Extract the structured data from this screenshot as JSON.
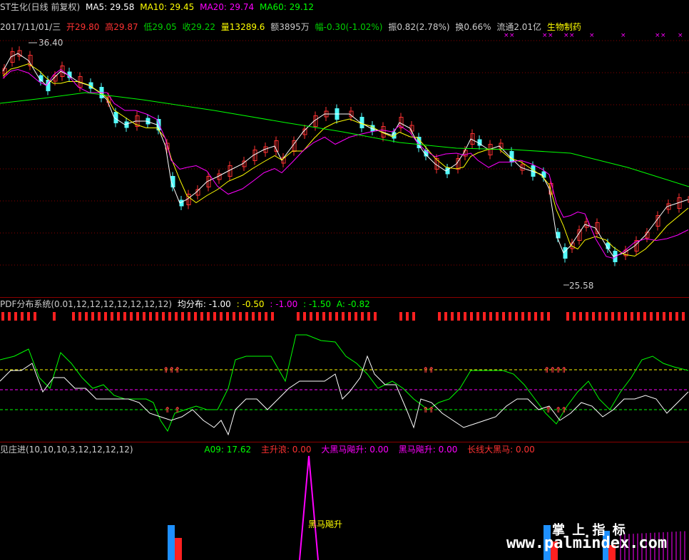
{
  "header": {
    "title": "ST生化(日线 前复权)",
    "ma5": "MA5: 29.58",
    "ma10": "MA10: 29.45",
    "ma20": "MA20: 29.74",
    "ma60": "MA60: 29.12"
  },
  "quote": {
    "date": "2017/11/01/三",
    "open": "开29.80",
    "high": "高29.87",
    "low": "低29.05",
    "close": "收29.22",
    "volume": "量13289.6",
    "amount": "额3895万",
    "change": "幅-0.30(-1.02%)",
    "amplitude": "振0.82(2.78%)",
    "turnover": "换0.66%",
    "float_cap": "流通2.01亿",
    "sector": "生物制药"
  },
  "price_labels": {
    "high": "36.40",
    "low": "25.58"
  },
  "pdf_panel": {
    "title": "PDF分布系统(0.01,12,12,12,12,12,12,12)",
    "avg_label": "均分布: -1.00",
    "v1": ": -0.50",
    "v2": ": -1.00",
    "v3": ": -1.50",
    "a": "A: -0.82"
  },
  "zhuang_panel": {
    "title": "见庄进(10,10,10,3,12,12,12,12)",
    "a09": "A09: 17.62",
    "zsl": "主升浪: 0.00",
    "dhmfs": "大黑马飚升: 0.00",
    "hmfs": "黑马飚升: 0.00",
    "cxdhm": "长线大黑马: 0.00",
    "annotation": "黑马飚升"
  },
  "watermark": {
    "cn": "掌 上 指 标",
    "url": "www.palmindex.com"
  },
  "colors": {
    "ma5": "#ffffff",
    "ma10": "#ffff00",
    "ma20": "#ff00ff",
    "ma60": "#00ff00",
    "up": "#ff3232",
    "down": "#54fcfc",
    "grid": "#8b0000"
  }
}
